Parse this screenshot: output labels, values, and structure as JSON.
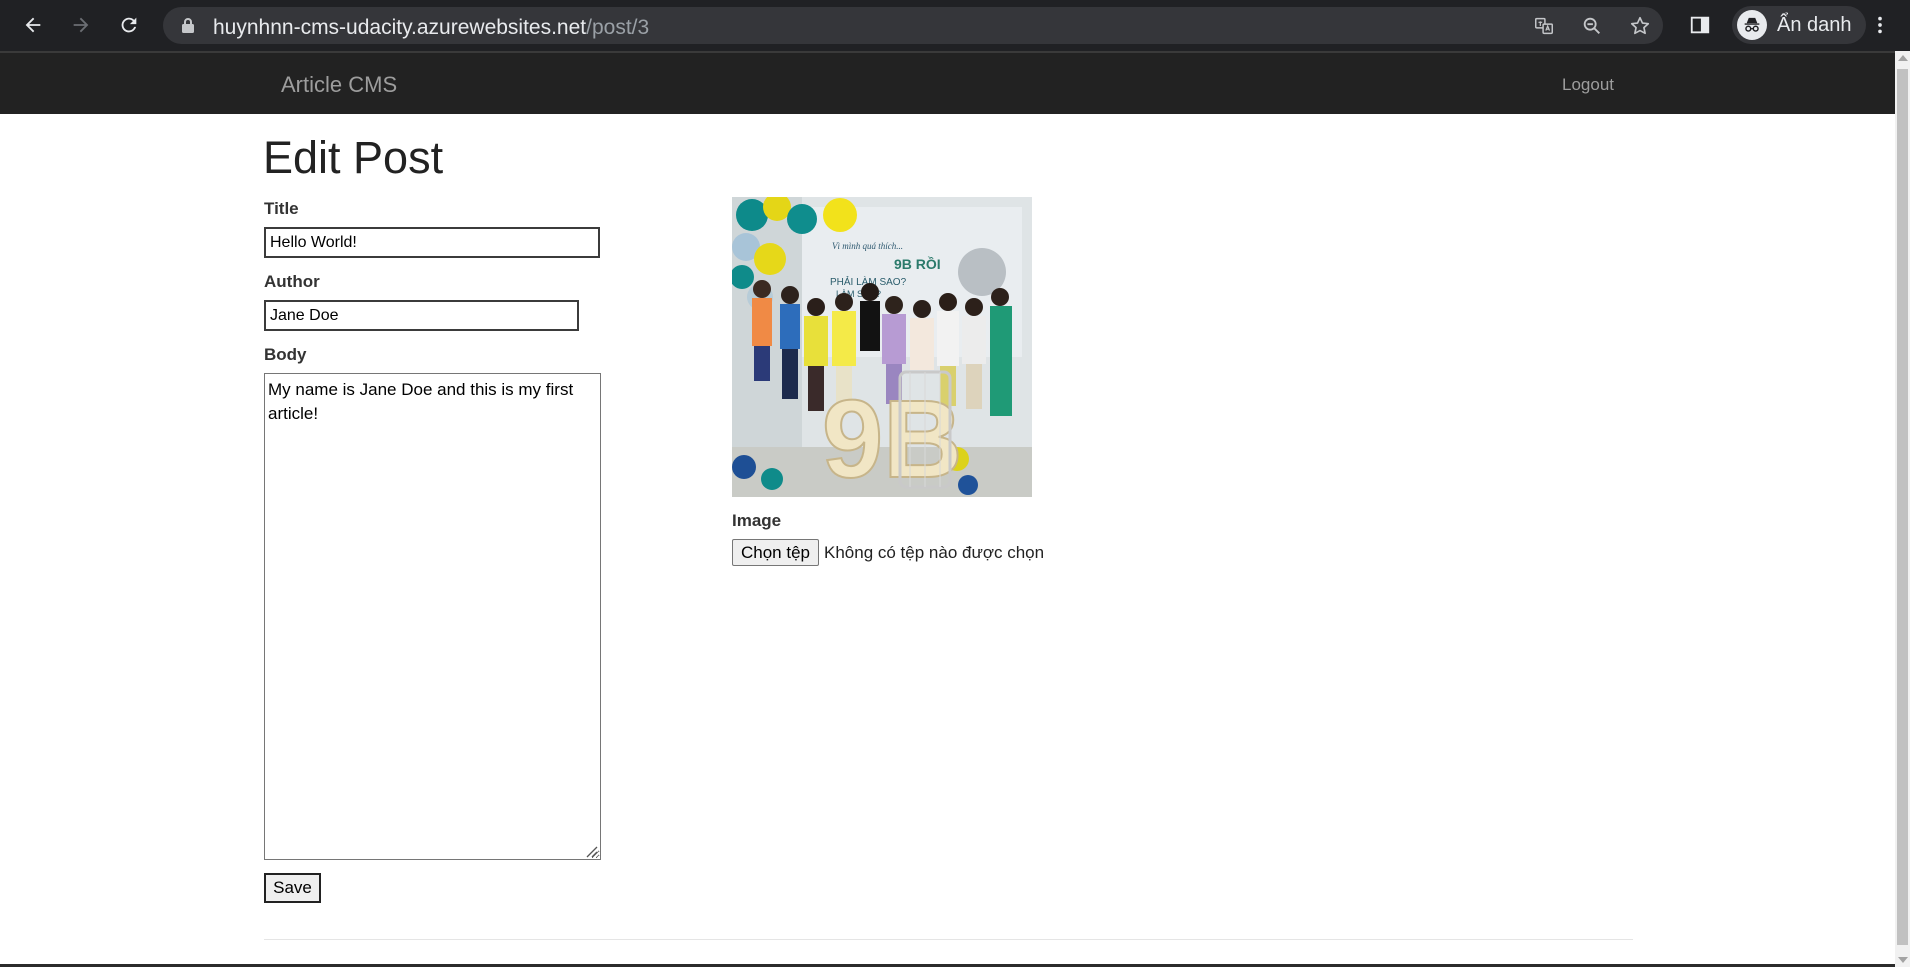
{
  "browser": {
    "url_host": "huynhnn-cms-udacity.azurewebsites.net",
    "url_path": "/post/3",
    "profile_label": "Ẩn danh"
  },
  "site": {
    "brand": "Article CMS",
    "logout": "Logout"
  },
  "page": {
    "title": "Edit Post"
  },
  "form": {
    "title_label": "Title",
    "title_value": "Hello World!",
    "author_label": "Author",
    "author_value": "Jane Doe",
    "body_label": "Body",
    "body_value": "My name is Jane Doe and this is my first article!",
    "image_label": "Image",
    "choose_file_label": "Chọn tệp",
    "no_file_text": "Không có tệp nào được chọn",
    "save_label": "Save"
  },
  "photo": {
    "banner_line1": "Vì mình quá thích...",
    "banner_line2": "9B RỒI",
    "banner_line3": "PHẢI LÀM SAO?",
    "banner_line4": "LÀM SAO?",
    "marquee": "9B"
  }
}
